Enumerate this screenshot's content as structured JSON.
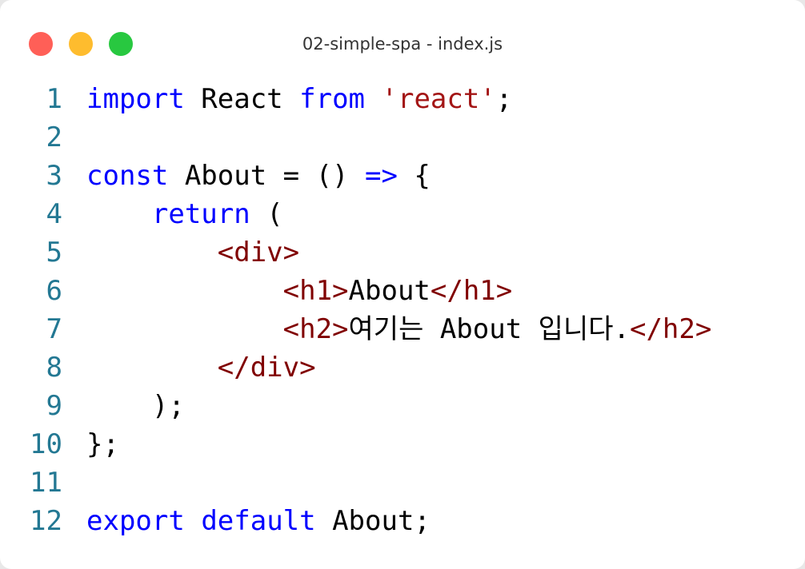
{
  "window": {
    "title": "02-simple-spa - index.js",
    "controls": [
      {
        "name": "close",
        "color": "#ff5f57"
      },
      {
        "name": "minimize",
        "color": "#febc2e"
      },
      {
        "name": "maximize",
        "color": "#28c840"
      }
    ]
  },
  "colors": {
    "keyword": "#0000ff",
    "string": "#a31515",
    "tag": "#800000",
    "text": "#000000",
    "line_number": "#237893"
  },
  "code": {
    "language": "javascript",
    "lines": [
      {
        "n": "1",
        "tokens": [
          {
            "t": "import",
            "k": "keyword"
          },
          {
            "t": " React ",
            "k": "text"
          },
          {
            "t": "from",
            "k": "keyword"
          },
          {
            "t": " ",
            "k": "text"
          },
          {
            "t": "'react'",
            "k": "string"
          },
          {
            "t": ";",
            "k": "text"
          }
        ]
      },
      {
        "n": "2",
        "tokens": []
      },
      {
        "n": "3",
        "tokens": [
          {
            "t": "const",
            "k": "keyword"
          },
          {
            "t": " About = () ",
            "k": "text"
          },
          {
            "t": "=>",
            "k": "keyword"
          },
          {
            "t": " {",
            "k": "text"
          }
        ]
      },
      {
        "n": "4",
        "tokens": [
          {
            "t": "    ",
            "k": "text"
          },
          {
            "t": "return",
            "k": "keyword"
          },
          {
            "t": " (",
            "k": "text"
          }
        ]
      },
      {
        "n": "5",
        "tokens": [
          {
            "t": "        ",
            "k": "text"
          },
          {
            "t": "<div>",
            "k": "tag"
          }
        ]
      },
      {
        "n": "6",
        "tokens": [
          {
            "t": "            ",
            "k": "text"
          },
          {
            "t": "<h1>",
            "k": "tag"
          },
          {
            "t": "About",
            "k": "text"
          },
          {
            "t": "</h1>",
            "k": "tag"
          }
        ]
      },
      {
        "n": "7",
        "tokens": [
          {
            "t": "            ",
            "k": "text"
          },
          {
            "t": "<h2>",
            "k": "tag"
          },
          {
            "t": "여기는 About 입니다.",
            "k": "text"
          },
          {
            "t": "</h2>",
            "k": "tag"
          }
        ]
      },
      {
        "n": "8",
        "tokens": [
          {
            "t": "        ",
            "k": "text"
          },
          {
            "t": "</div>",
            "k": "tag"
          }
        ]
      },
      {
        "n": "9",
        "tokens": [
          {
            "t": "    );",
            "k": "text"
          }
        ]
      },
      {
        "n": "10",
        "tokens": [
          {
            "t": "};",
            "k": "text"
          }
        ]
      },
      {
        "n": "11",
        "tokens": []
      },
      {
        "n": "12",
        "tokens": [
          {
            "t": "export",
            "k": "keyword"
          },
          {
            "t": " ",
            "k": "text"
          },
          {
            "t": "default",
            "k": "keyword"
          },
          {
            "t": " About;",
            "k": "text"
          }
        ]
      }
    ]
  }
}
